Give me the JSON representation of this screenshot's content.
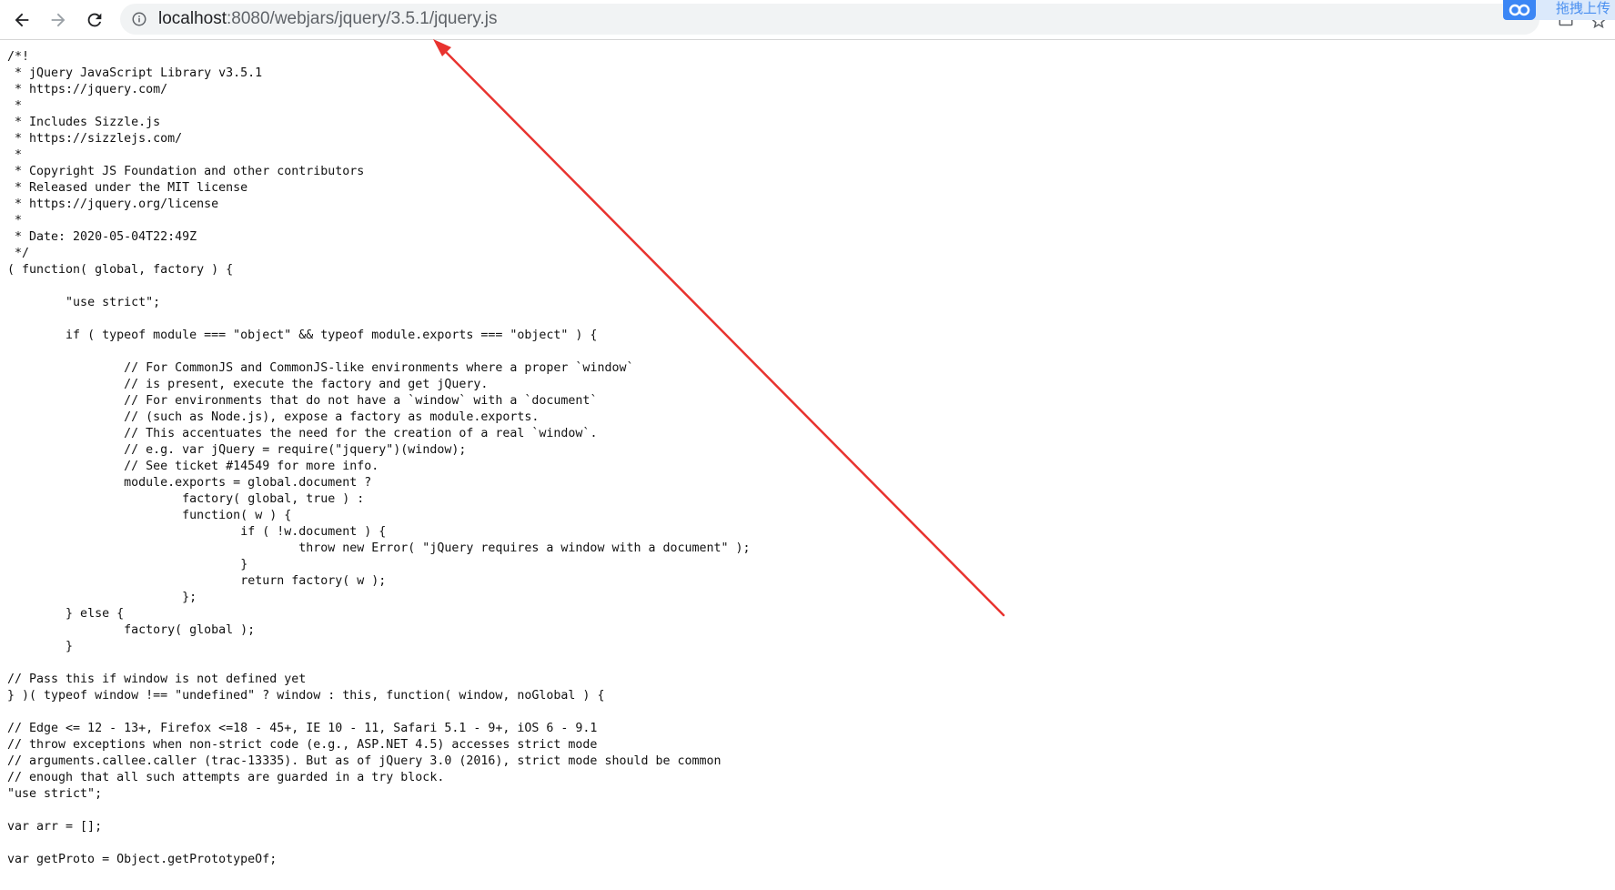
{
  "browser": {
    "url_host": "localhost",
    "url_path": ":8080/webjars/jquery/3.5.1/jquery.js",
    "back_icon": "arrow-left-icon",
    "forward_icon": "arrow-right-icon",
    "reload_icon": "reload-icon",
    "info_icon": "info-icon",
    "star_icon": "star-icon"
  },
  "overlay": {
    "label": "拖拽上传",
    "icon": "cloud-logo-icon",
    "color": "#3b86f5"
  },
  "annotation": {
    "color": "#e8332f",
    "icon": "red-arrow"
  },
  "source_code": "/*!\n * jQuery JavaScript Library v3.5.1\n * https://jquery.com/\n *\n * Includes Sizzle.js\n * https://sizzlejs.com/\n *\n * Copyright JS Foundation and other contributors\n * Released under the MIT license\n * https://jquery.org/license\n *\n * Date: 2020-05-04T22:49Z\n */\n( function( global, factory ) {\n\n\t\"use strict\";\n\n\tif ( typeof module === \"object\" && typeof module.exports === \"object\" ) {\n\n\t\t// For CommonJS and CommonJS-like environments where a proper `window`\n\t\t// is present, execute the factory and get jQuery.\n\t\t// For environments that do not have a `window` with a `document`\n\t\t// (such as Node.js), expose a factory as module.exports.\n\t\t// This accentuates the need for the creation of a real `window`.\n\t\t// e.g. var jQuery = require(\"jquery\")(window);\n\t\t// See ticket #14549 for more info.\n\t\tmodule.exports = global.document ?\n\t\t\tfactory( global, true ) :\n\t\t\tfunction( w ) {\n\t\t\t\tif ( !w.document ) {\n\t\t\t\t\tthrow new Error( \"jQuery requires a window with a document\" );\n\t\t\t\t}\n\t\t\t\treturn factory( w );\n\t\t\t};\n\t} else {\n\t\tfactory( global );\n\t}\n\n// Pass this if window is not defined yet\n} )( typeof window !== \"undefined\" ? window : this, function( window, noGlobal ) {\n\n// Edge <= 12 - 13+, Firefox <=18 - 45+, IE 10 - 11, Safari 5.1 - 9+, iOS 6 - 9.1\n// throw exceptions when non-strict code (e.g., ASP.NET 4.5) accesses strict mode\n// arguments.callee.caller (trac-13335). But as of jQuery 3.0 (2016), strict mode should be common\n// enough that all such attempts are guarded in a try block.\n\"use strict\";\n\nvar arr = [];\n\nvar getProto = Object.getPrototypeOf;\n\nvar slice = arr.slice;"
}
